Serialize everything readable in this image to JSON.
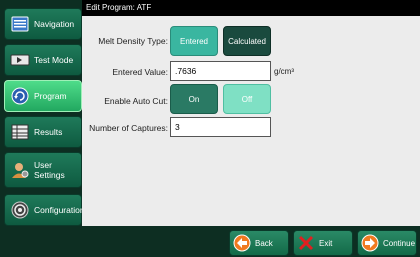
{
  "header": {
    "title": "Edit Program:  ATF"
  },
  "sidebar": {
    "items": [
      {
        "label": "Navigation",
        "icon": "navigation-list-icon",
        "active": false
      },
      {
        "label": "Test Mode",
        "icon": "test-mode-icon",
        "active": false
      },
      {
        "label": "Program",
        "icon": "program-icon",
        "active": true
      },
      {
        "label": "Results",
        "icon": "results-icon",
        "active": false
      },
      {
        "label": "User Settings",
        "icon": "user-settings-icon",
        "active": false
      },
      {
        "label": "Configuration",
        "icon": "configuration-icon",
        "active": false
      }
    ]
  },
  "form": {
    "melt_density_type_label": "Melt Density Type:",
    "melt_density_entered": "Entered",
    "melt_density_calculated": "Calculated",
    "entered_value_label": "Entered Value:",
    "entered_value": ".7636",
    "entered_value_unit": "g/cm³",
    "auto_cut_label": "Enable Auto Cut:",
    "auto_cut_on": "On",
    "auto_cut_off": "Off",
    "captures_label": "Number of Captures:",
    "captures_value": "3"
  },
  "bottom": {
    "back": "Back",
    "exit": "Exit",
    "continue": "Continue"
  },
  "colors": {
    "sidebar_bg": "#0d2e22",
    "nav_button": "#1f7a5a",
    "nav_active": "#4fdc8a",
    "toggle_selected": "#3ab6a0",
    "toggle_unselected": "#1a4a3e",
    "main_bg": "#ececec"
  }
}
